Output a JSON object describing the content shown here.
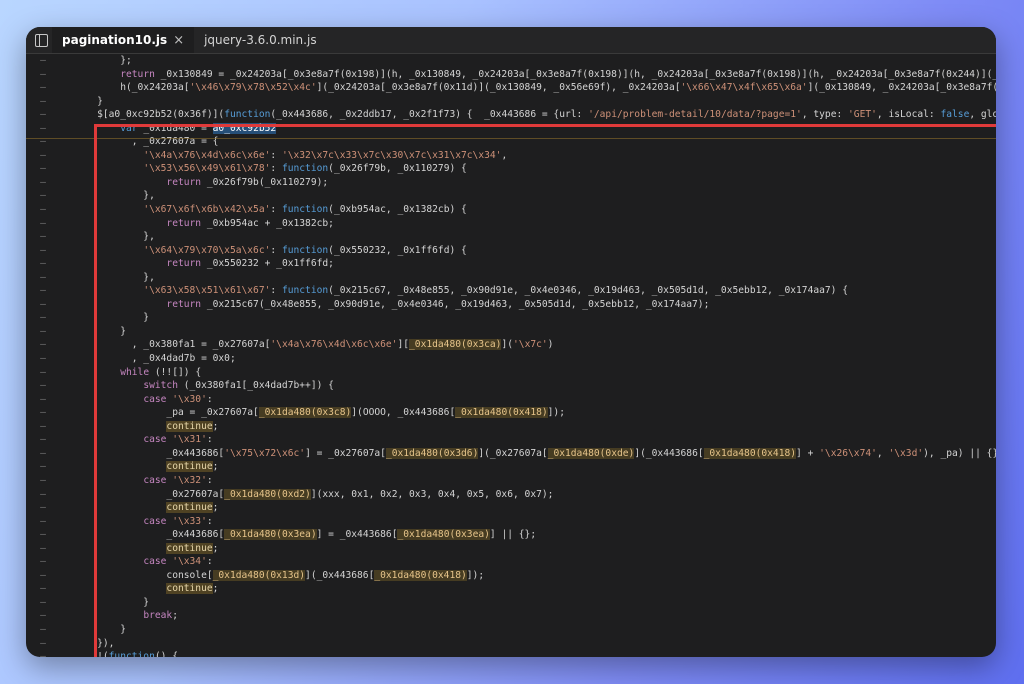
{
  "tabs": [
    {
      "label": "pagination10.js",
      "close": "×",
      "active": true
    },
    {
      "label": "jquery-3.6.0.min.js",
      "close": "",
      "active": false
    }
  ],
  "gutter_mark": "–",
  "lines": [
    {
      "text": "        };"
    },
    {
      "text": "        return _0x130849 = _0x24203a[_0x3e8a7f(0x198)](h, _0x130849, _0x24203a[_0x3e8a7f(0x198)](h, _0x24203a[_0x3e8a7f(0x198)](h, _0x24203a[_0x3e8a7f(0x244)](_0x2"
    },
    {
      "text": "        h(_0x24203a['\\x46\\x79\\x78\\x52\\x4c'](_0x24203a[_0x3e8a7f(0x11d)](_0x130849, _0x56e69f), _0x24203a['\\x66\\x47\\x4f\\x65\\x6a'](_0x130849, _0x24203a[_0x3e8a7f(0x"
    },
    {
      "text": "    }"
    },
    {
      "text": "    $[a0_0xc92b52(0x36f)](function(_0x443686, _0x2ddb17, _0x2f1f73) {  _0x443686 = {url: '/api/problem-detail/10/data/?page=1', type: 'GET', isLocal: false, glob"
    },
    {
      "text": "        var _0x1da480 = a0_0xc92b52"
    },
    {
      "text": "          , _0x27607a = {"
    },
    {
      "text": "            '\\x4a\\x76\\x4d\\x6c\\x6e': '\\x32\\x7c\\x33\\x7c\\x30\\x7c\\x31\\x7c\\x34',"
    },
    {
      "text": "            '\\x53\\x56\\x49\\x61\\x78': function(_0x26f79b, _0x110279) {"
    },
    {
      "text": "                return _0x26f79b(_0x110279);"
    },
    {
      "text": "            },"
    },
    {
      "text": "            '\\x67\\x6f\\x6b\\x42\\x5a': function(_0xb954ac, _0x1382cb) {"
    },
    {
      "text": "                return _0xb954ac + _0x1382cb;"
    },
    {
      "text": "            },"
    },
    {
      "text": "            '\\x64\\x79\\x70\\x5a\\x6c': function(_0x550232, _0x1ff6fd) {"
    },
    {
      "text": "                return _0x550232 + _0x1ff6fd;"
    },
    {
      "text": "            },"
    },
    {
      "text": "            '\\x63\\x58\\x51\\x61\\x67': function(_0x215c67, _0x48e855, _0x90d91e, _0x4e0346, _0x19d463, _0x505d1d, _0x5ebb12, _0x174aa7) {"
    },
    {
      "text": "                return _0x215c67(_0x48e855, _0x90d91e, _0x4e0346, _0x19d463, _0x505d1d, _0x5ebb12, _0x174aa7);"
    },
    {
      "text": "            }"
    },
    {
      "text": "        }"
    },
    {
      "text": "          , _0x380fa1 = _0x27607a['\\x4a\\x76\\x4d\\x6c\\x6e'][_0x1da480(0x3ca)]('\\x7c')"
    },
    {
      "text": "          , _0x4dad7b = 0x0;"
    },
    {
      "text": "        while (!![]) {"
    },
    {
      "text": "            switch (_0x380fa1[_0x4dad7b++]) {"
    },
    {
      "text": "            case '\\x30':"
    },
    {
      "text": "                _pa = _0x27607a[_0x1da480(0x3c8)](OOOO, _0x443686[_0x1da480(0x418)]);"
    },
    {
      "text": "                continue;"
    },
    {
      "text": "            case '\\x31':"
    },
    {
      "text": "                _0x443686['\\x75\\x72\\x6c'] = _0x27607a[_0x1da480(0x3d6)](_0x27607a[_0x1da480(0xde)](_0x443686[_0x1da480(0x418)] + '\\x26\\x74', '\\x3d'), _pa) || {};"
    },
    {
      "text": "                continue;"
    },
    {
      "text": "            case '\\x32':"
    },
    {
      "text": "                _0x27607a[_0x1da480(0xd2)](xxx, 0x1, 0x2, 0x3, 0x4, 0x5, 0x6, 0x7);"
    },
    {
      "text": "                continue;"
    },
    {
      "text": "            case '\\x33':"
    },
    {
      "text": "                _0x443686[_0x1da480(0x3ea)] = _0x443686[_0x1da480(0x3ea)] || {};"
    },
    {
      "text": "                continue;"
    },
    {
      "text": "            case '\\x34':"
    },
    {
      "text": "                console[_0x1da480(0x13d)](_0x443686[_0x1da480(0x418)]);"
    },
    {
      "text": "                continue;"
    },
    {
      "text": "            }"
    },
    {
      "text": "            break;"
    },
    {
      "text": "        }"
    },
    {
      "text": "    }),"
    },
    {
      "text": "    !(function() {"
    }
  ],
  "colors": {
    "highlight_box": "#e03a3a",
    "editor_bg": "#1e1e1f",
    "selection": "#264f78"
  }
}
